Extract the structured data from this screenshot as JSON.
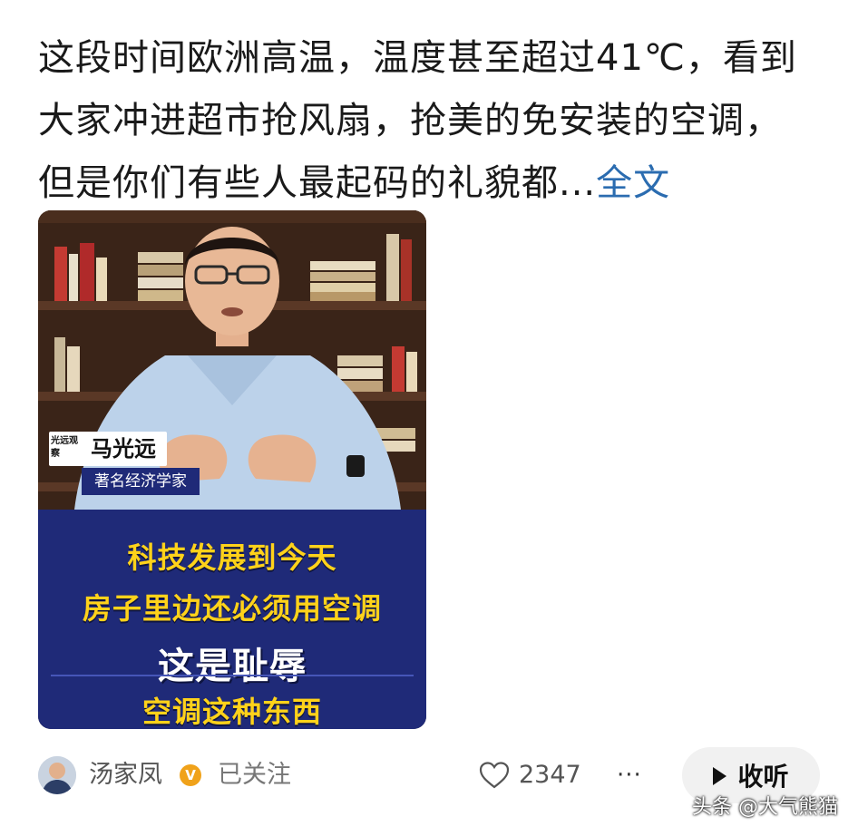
{
  "post": {
    "text": "这段时间欧洲高温，温度甚至超过41℃，看到大家冲进超市抢风扇，抢美的免安装的空调，但是你们有些人最起码的礼貌都...",
    "full_link": "全文"
  },
  "video": {
    "brand_mark": "光远观察",
    "name_tag": "马光远",
    "title_tag": "著名经济学家",
    "captions": [
      "科技发展到今天",
      "房子里边还必须用空调",
      "这是耻辱",
      "空调这种东西"
    ]
  },
  "footer": {
    "author": "汤家凤",
    "verified": "V",
    "follow_state": "已关注",
    "like_count": "2347",
    "more": "···",
    "listen_label": "收听"
  },
  "watermark": "头条 @大气熊猫",
  "colors": {
    "link": "#2b6cb0",
    "caption_panel": "#1f2a78",
    "caption_text": "#ffd21a",
    "verified": "#f0a21a"
  }
}
